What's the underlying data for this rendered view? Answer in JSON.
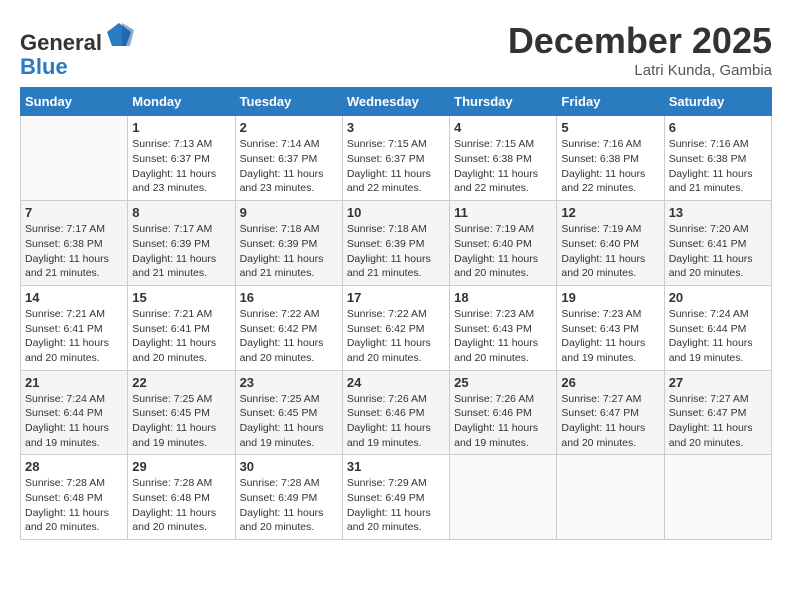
{
  "header": {
    "logo_line1": "General",
    "logo_line2": "Blue",
    "month": "December 2025",
    "location": "Latri Kunda, Gambia"
  },
  "days_of_week": [
    "Sunday",
    "Monday",
    "Tuesday",
    "Wednesday",
    "Thursday",
    "Friday",
    "Saturday"
  ],
  "weeks": [
    [
      {
        "day": "",
        "sunrise": "",
        "sunset": "",
        "daylight": ""
      },
      {
        "day": "1",
        "sunrise": "Sunrise: 7:13 AM",
        "sunset": "Sunset: 6:37 PM",
        "daylight": "Daylight: 11 hours and 23 minutes."
      },
      {
        "day": "2",
        "sunrise": "Sunrise: 7:14 AM",
        "sunset": "Sunset: 6:37 PM",
        "daylight": "Daylight: 11 hours and 23 minutes."
      },
      {
        "day": "3",
        "sunrise": "Sunrise: 7:15 AM",
        "sunset": "Sunset: 6:37 PM",
        "daylight": "Daylight: 11 hours and 22 minutes."
      },
      {
        "day": "4",
        "sunrise": "Sunrise: 7:15 AM",
        "sunset": "Sunset: 6:38 PM",
        "daylight": "Daylight: 11 hours and 22 minutes."
      },
      {
        "day": "5",
        "sunrise": "Sunrise: 7:16 AM",
        "sunset": "Sunset: 6:38 PM",
        "daylight": "Daylight: 11 hours and 22 minutes."
      },
      {
        "day": "6",
        "sunrise": "Sunrise: 7:16 AM",
        "sunset": "Sunset: 6:38 PM",
        "daylight": "Daylight: 11 hours and 21 minutes."
      }
    ],
    [
      {
        "day": "7",
        "sunrise": "Sunrise: 7:17 AM",
        "sunset": "Sunset: 6:38 PM",
        "daylight": "Daylight: 11 hours and 21 minutes."
      },
      {
        "day": "8",
        "sunrise": "Sunrise: 7:17 AM",
        "sunset": "Sunset: 6:39 PM",
        "daylight": "Daylight: 11 hours and 21 minutes."
      },
      {
        "day": "9",
        "sunrise": "Sunrise: 7:18 AM",
        "sunset": "Sunset: 6:39 PM",
        "daylight": "Daylight: 11 hours and 21 minutes."
      },
      {
        "day": "10",
        "sunrise": "Sunrise: 7:18 AM",
        "sunset": "Sunset: 6:39 PM",
        "daylight": "Daylight: 11 hours and 21 minutes."
      },
      {
        "day": "11",
        "sunrise": "Sunrise: 7:19 AM",
        "sunset": "Sunset: 6:40 PM",
        "daylight": "Daylight: 11 hours and 20 minutes."
      },
      {
        "day": "12",
        "sunrise": "Sunrise: 7:19 AM",
        "sunset": "Sunset: 6:40 PM",
        "daylight": "Daylight: 11 hours and 20 minutes."
      },
      {
        "day": "13",
        "sunrise": "Sunrise: 7:20 AM",
        "sunset": "Sunset: 6:41 PM",
        "daylight": "Daylight: 11 hours and 20 minutes."
      }
    ],
    [
      {
        "day": "14",
        "sunrise": "Sunrise: 7:21 AM",
        "sunset": "Sunset: 6:41 PM",
        "daylight": "Daylight: 11 hours and 20 minutes."
      },
      {
        "day": "15",
        "sunrise": "Sunrise: 7:21 AM",
        "sunset": "Sunset: 6:41 PM",
        "daylight": "Daylight: 11 hours and 20 minutes."
      },
      {
        "day": "16",
        "sunrise": "Sunrise: 7:22 AM",
        "sunset": "Sunset: 6:42 PM",
        "daylight": "Daylight: 11 hours and 20 minutes."
      },
      {
        "day": "17",
        "sunrise": "Sunrise: 7:22 AM",
        "sunset": "Sunset: 6:42 PM",
        "daylight": "Daylight: 11 hours and 20 minutes."
      },
      {
        "day": "18",
        "sunrise": "Sunrise: 7:23 AM",
        "sunset": "Sunset: 6:43 PM",
        "daylight": "Daylight: 11 hours and 20 minutes."
      },
      {
        "day": "19",
        "sunrise": "Sunrise: 7:23 AM",
        "sunset": "Sunset: 6:43 PM",
        "daylight": "Daylight: 11 hours and 19 minutes."
      },
      {
        "day": "20",
        "sunrise": "Sunrise: 7:24 AM",
        "sunset": "Sunset: 6:44 PM",
        "daylight": "Daylight: 11 hours and 19 minutes."
      }
    ],
    [
      {
        "day": "21",
        "sunrise": "Sunrise: 7:24 AM",
        "sunset": "Sunset: 6:44 PM",
        "daylight": "Daylight: 11 hours and 19 minutes."
      },
      {
        "day": "22",
        "sunrise": "Sunrise: 7:25 AM",
        "sunset": "Sunset: 6:45 PM",
        "daylight": "Daylight: 11 hours and 19 minutes."
      },
      {
        "day": "23",
        "sunrise": "Sunrise: 7:25 AM",
        "sunset": "Sunset: 6:45 PM",
        "daylight": "Daylight: 11 hours and 19 minutes."
      },
      {
        "day": "24",
        "sunrise": "Sunrise: 7:26 AM",
        "sunset": "Sunset: 6:46 PM",
        "daylight": "Daylight: 11 hours and 19 minutes."
      },
      {
        "day": "25",
        "sunrise": "Sunrise: 7:26 AM",
        "sunset": "Sunset: 6:46 PM",
        "daylight": "Daylight: 11 hours and 19 minutes."
      },
      {
        "day": "26",
        "sunrise": "Sunrise: 7:27 AM",
        "sunset": "Sunset: 6:47 PM",
        "daylight": "Daylight: 11 hours and 20 minutes."
      },
      {
        "day": "27",
        "sunrise": "Sunrise: 7:27 AM",
        "sunset": "Sunset: 6:47 PM",
        "daylight": "Daylight: 11 hours and 20 minutes."
      }
    ],
    [
      {
        "day": "28",
        "sunrise": "Sunrise: 7:28 AM",
        "sunset": "Sunset: 6:48 PM",
        "daylight": "Daylight: 11 hours and 20 minutes."
      },
      {
        "day": "29",
        "sunrise": "Sunrise: 7:28 AM",
        "sunset": "Sunset: 6:48 PM",
        "daylight": "Daylight: 11 hours and 20 minutes."
      },
      {
        "day": "30",
        "sunrise": "Sunrise: 7:28 AM",
        "sunset": "Sunset: 6:49 PM",
        "daylight": "Daylight: 11 hours and 20 minutes."
      },
      {
        "day": "31",
        "sunrise": "Sunrise: 7:29 AM",
        "sunset": "Sunset: 6:49 PM",
        "daylight": "Daylight: 11 hours and 20 minutes."
      },
      {
        "day": "",
        "sunrise": "",
        "sunset": "",
        "daylight": ""
      },
      {
        "day": "",
        "sunrise": "",
        "sunset": "",
        "daylight": ""
      },
      {
        "day": "",
        "sunrise": "",
        "sunset": "",
        "daylight": ""
      }
    ]
  ]
}
